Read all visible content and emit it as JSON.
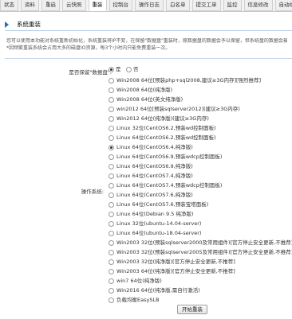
{
  "tabs": [
    "状态",
    "资料",
    "重启",
    "云快照",
    "重装",
    "控制台",
    "操作日志",
    "白名单",
    "提交工单",
    "监控",
    "信息修改",
    "自动续"
  ],
  "active_tab": "重装",
  "section_title": "系统重装",
  "notice_line1": "您可以使用本功能对系统重新初始化，系统重装将IP不变，在保留\"数据盘\"重装时，原数据盘的数据会予以保留，但系统盘的数据会被",
  "notice_line2": "*因频繁重装系统会占用大多的磁盘IO资源，每3个小时内只能免费重装一次。",
  "keep_disk_label": "是否保留\"数据盘\":",
  "yes_label": "是",
  "no_label": "否",
  "os_label": "操作系统:",
  "os_options": [
    "Win2008 64位[预装php+sql2008,建议≥3G内存][强烈推荐]",
    "Win2008 64位(纯净版)",
    "Win2008 64位(英文纯净版)",
    "win2012 64位[预装sqlserver2012](建议≥3G内存)",
    "Win2012 64位(纯净版)(建议≥3G内存)",
    "Linux 32位(CentOS6.2,预装wd控制面板)",
    "Linux 64位(CentOS6.2,预装wd控制面板)",
    "Linux 64位(CentOS6.4,纯净版)",
    "Linux 64位(CentOS6.9,预装wdcp控制面板)",
    "Linux 64位(CentOS6.9,纯净版)",
    "Linux 64位(CentOS7.4,纯净版)",
    "Linux 64位(CentOS7.4,预装wdcp控制面板)",
    "Linux 64位(CentOS7.6,纯净版)",
    "Linux 64位(CentOS7.6,预装宝塔面板)",
    "Linux 64位(Debian 9.5 纯净版)",
    "Linux 32位(ubuntu-14.04-server)",
    "Linux 64位(ubuntu-18.04-server)",
    "Win2003 32位(预装sqlserver2000及常用组件)[官方停止安全更新,不推荐]",
    "Win2003 32位(预装sqlserver2005及常用组件)[官方停止安全更新,不推荐]",
    "Win2003 32位(纯净版)[官方停止安全更新,不推荐]",
    "Win2003 64位(纯净版)[官方停止安全更新,不推荐]",
    "win7 64位(纯净版)",
    "Win2016 64位(纯净版,需自行激活)",
    "负载均衡EasySLB"
  ],
  "selected_os_index": 7,
  "submit_label": "开始重装"
}
